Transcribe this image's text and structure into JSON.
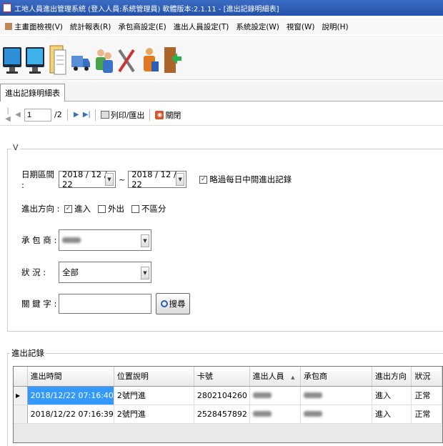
{
  "window": {
    "title": "工地人員進出管理系統 (登入人員:系統管理員)  軟體版本:2.1.11 - [進出記錄明細表]"
  },
  "menu": [
    {
      "label": "主畫面檢視(V)",
      "icon": "app-menu-icon"
    },
    {
      "label": "統計報表(R)"
    },
    {
      "label": "承包商設定(E)"
    },
    {
      "label": "進出人員設定(T)"
    },
    {
      "label": "系統設定(W)"
    },
    {
      "label": "視窗(W)"
    },
    {
      "label": "說明(H)"
    }
  ],
  "toolbar_icons": [
    "monitor-icon",
    "monitor-icon",
    "document-icon",
    "truck-icon",
    "people-icon",
    "tools-icon",
    "user-group-icon",
    "exit-door-icon"
  ],
  "tab": {
    "label": "進出記錄明細表"
  },
  "pager": {
    "current_page": "1",
    "total_pages": "/2",
    "print_label": "列印/匯出",
    "close_label": "關閉"
  },
  "filter": {
    "legend": "V",
    "date_label": "日期區間 :",
    "date_from": "2018 / 12 / 22",
    "date_tilde": "~",
    "date_to": "2018 / 12 / 22",
    "skip_midday_label": "略過每日中間進出記錄",
    "skip_midday_checked": true,
    "direction_label": "進出方向 :",
    "direction_in": "進入",
    "direction_in_checked": true,
    "direction_out": "外出",
    "direction_out_checked": false,
    "direction_any": "不區分",
    "direction_any_checked": false,
    "contractor_label": "承 包 商 :",
    "status_label": "狀      況 :",
    "status_value": "全部",
    "keyword_label": "關 鍵 字 :",
    "keyword_value": "",
    "search_label": "搜尋"
  },
  "records": {
    "legend": "進出記錄",
    "columns": [
      "進出時間",
      "位置說明",
      "卡號",
      "進出人員",
      "承包商",
      "進出方向",
      "狀況"
    ],
    "sort_indicator": "▲",
    "rows": [
      {
        "time": "2018/12/22 07:16:40",
        "location": "2號門進",
        "card": "2802104260",
        "direction": "進入",
        "status": "正常"
      },
      {
        "time": "2018/12/22 07:16:39",
        "location": "2號門進",
        "card": "2528457892",
        "direction": "進入",
        "status": "正常"
      }
    ]
  }
}
